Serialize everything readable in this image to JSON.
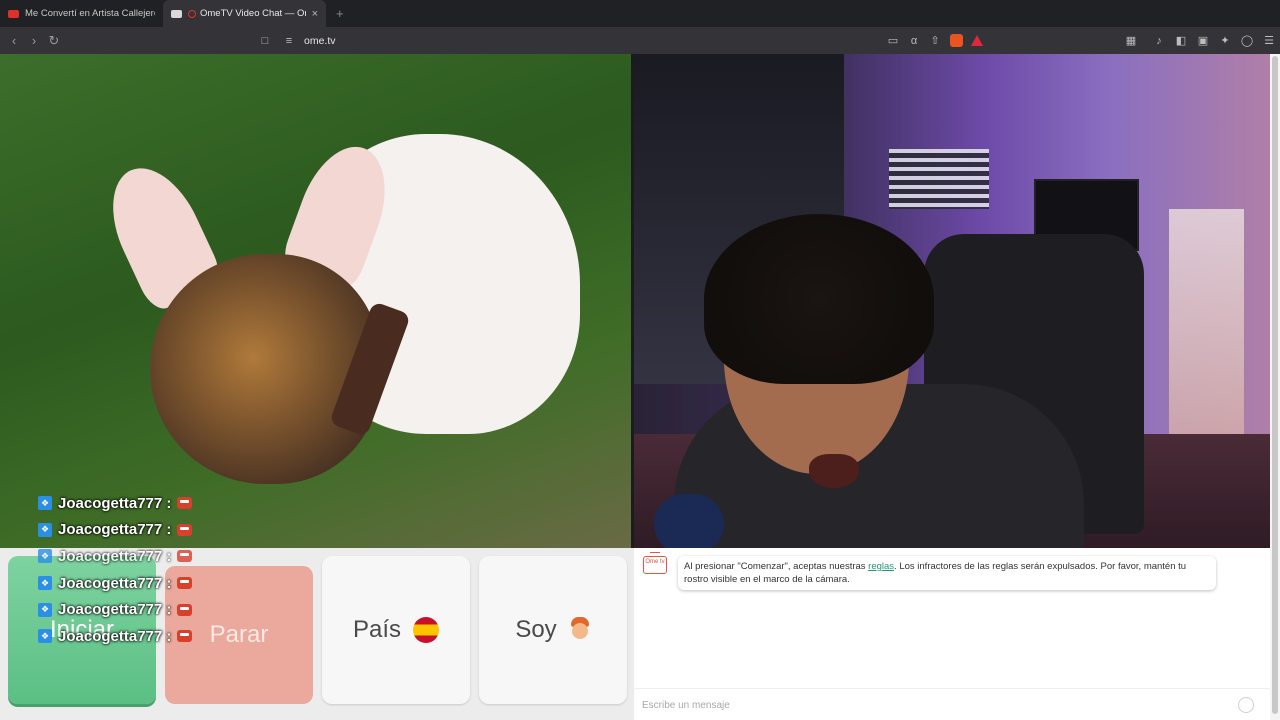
{
  "browser": {
    "tabs": [
      {
        "title": "Me Convertí en Artista Callejero co",
        "active": false,
        "favicon": "youtube-icon"
      },
      {
        "title": "OmeTV Video Chat — Omeg",
        "active": true,
        "favicon": "mail-icon"
      }
    ],
    "new_tab": "+",
    "close": "×",
    "url": "ome.tv",
    "nav": {
      "back": "‹",
      "forward": "›",
      "reload": "↻"
    }
  },
  "controls": {
    "start_label": "Iniciar",
    "stop_label": "Parar",
    "country_label": "País",
    "gender_label": "Soy"
  },
  "chat_overlay": {
    "lines": [
      {
        "user": "Joacogetta777 :"
      },
      {
        "user": "Joacogetta777 :"
      },
      {
        "user": "Joacogetta777 :"
      },
      {
        "user": "Joacogetta777 :"
      },
      {
        "user": "Joacogetta777 :"
      },
      {
        "user": "Joacogetta777 :"
      }
    ]
  },
  "chatpanel": {
    "logo": "Ome tv",
    "notice_pre": "Al presionar \"Comenzar\", aceptas nuestras ",
    "notice_link": "reglas",
    "notice_post": ". Los infractores de las reglas serán expulsados. Por favor, mantén tu rostro visible en el marco de la cámara.",
    "input_placeholder": "Escribe un mensaje"
  },
  "colors": {
    "start": "#6fcb94",
    "stop": "#eaa99c",
    "link": "#1d9a6c",
    "brand": "#e8523f"
  }
}
